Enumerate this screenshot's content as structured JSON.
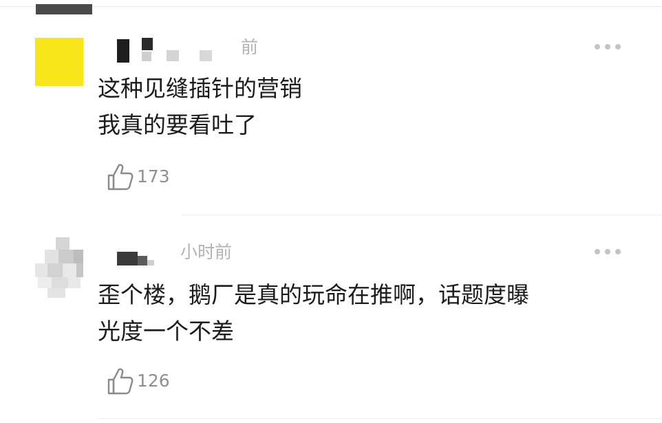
{
  "comments": [
    {
      "time_suffix": "前",
      "text_lines": [
        "这种见缝插针的营销",
        "我真的要看吐了"
      ],
      "likes": "173",
      "avatar_color": "#f7e619"
    },
    {
      "time_suffix": "小时前",
      "text_lines": [
        "歪个楼，鹅厂是真的玩命在推啊，话题度曝",
        "光度一个不差"
      ],
      "likes": "126",
      "avatar_color": "#d9d9d9"
    }
  ],
  "icons": {
    "like": "thumbs-up-icon",
    "more": "more-horizontal-icon"
  }
}
